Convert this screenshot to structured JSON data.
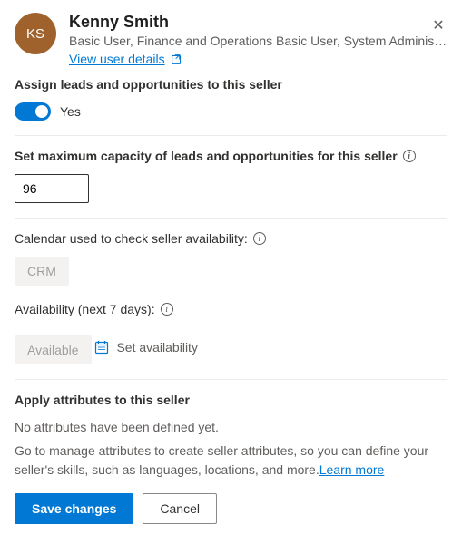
{
  "header": {
    "avatar_initials": "KS",
    "name": "Kenny Smith",
    "roles": "Basic User, Finance and Operations Basic User, System Administr…",
    "view_link": "View user details"
  },
  "assign": {
    "label": "Assign leads and opportunities to this seller",
    "toggle_value": "Yes"
  },
  "capacity": {
    "label": "Set maximum capacity of leads and opportunities for this seller",
    "value": "96"
  },
  "calendar": {
    "label": "Calendar used to check seller availability:",
    "value": "CRM"
  },
  "availability": {
    "label": "Availability (next 7 days):",
    "value": "Available",
    "set_link": "Set availability"
  },
  "attributes": {
    "heading": "Apply attributes to this seller",
    "empty": "No attributes have been defined yet.",
    "help": "Go to manage attributes to create seller attributes, so you can define your seller's skills, such as languages, locations, and more.",
    "learn_more": "Learn more"
  },
  "buttons": {
    "save": "Save changes",
    "cancel": "Cancel"
  }
}
